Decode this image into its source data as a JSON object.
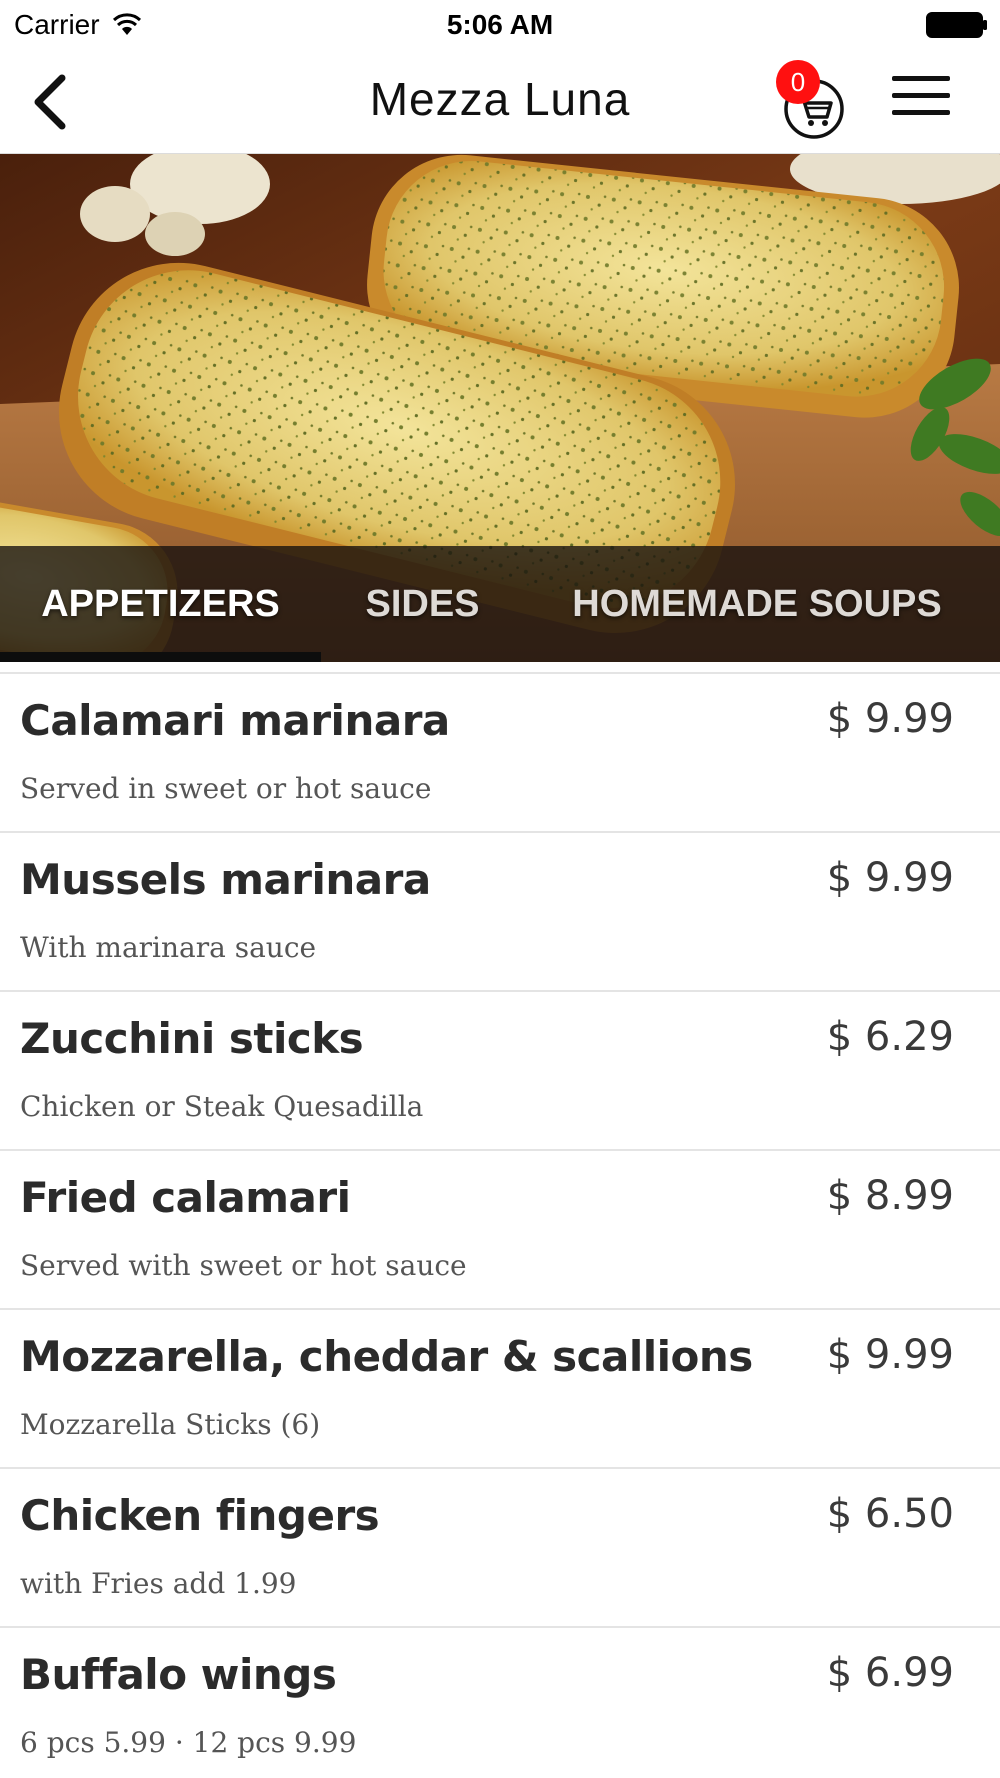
{
  "status_bar": {
    "carrier": "Carrier",
    "time": "5:06 AM",
    "icons": [
      "wifi-icon",
      "battery-icon"
    ]
  },
  "nav": {
    "title": "Mezza Luna",
    "cart_count": "0",
    "icons": [
      "back-chevron-icon",
      "cart-icon",
      "hamburger-menu-icon"
    ],
    "badge_color": "#ff1010"
  },
  "hero": {
    "image": "garlic-bread-photo"
  },
  "tabs": [
    {
      "label": "APPETIZERS",
      "selected": true
    },
    {
      "label": "SIDES",
      "selected": false
    },
    {
      "label": "HOMEMADE SOUPS",
      "selected": false
    }
  ],
  "menu_items": [
    {
      "name": "Calamari marinara",
      "price": "$ 9.99",
      "description": "Served in sweet or hot sauce"
    },
    {
      "name": "Mussels marinara",
      "price": "$ 9.99",
      "description": "With marinara sauce"
    },
    {
      "name": "Zucchini sticks",
      "price": "$ 6.29",
      "description": "Chicken or Steak Quesadilla"
    },
    {
      "name": "Fried calamari",
      "price": "$ 8.99",
      "description": "Served with sweet or hot sauce"
    },
    {
      "name": "Mozzarella, cheddar & scallions",
      "price": "$ 9.99",
      "description": "Mozzarella Sticks (6)"
    },
    {
      "name": "Chicken fingers",
      "price": "$ 6.50",
      "description": "with Fries add  1.99"
    },
    {
      "name": "Buffalo wings",
      "price": "$ 6.99",
      "description": "6 pcs 5.99 · 12 pcs 9.99"
    }
  ]
}
